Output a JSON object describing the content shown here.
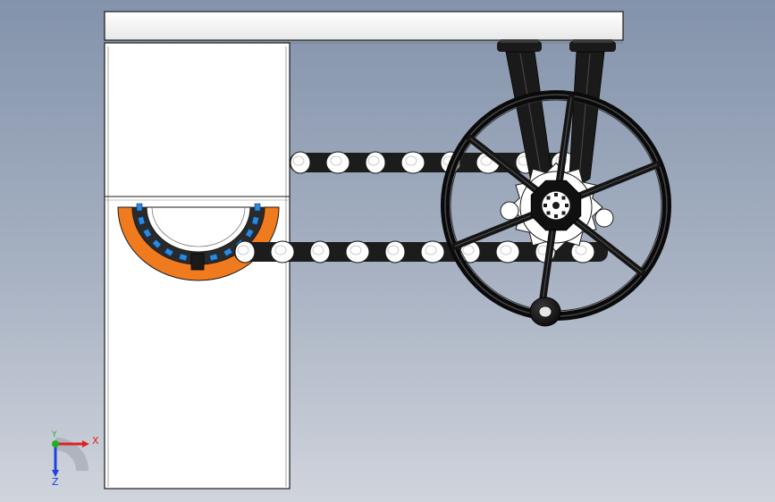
{
  "viewport": {
    "background": "gradient-grey-blue"
  },
  "model": {
    "components": [
      "top-beam",
      "vertical-column",
      "large-sprocket-cutaway",
      "roller-chain-top",
      "roller-chain-bottom",
      "small-sprocket",
      "handwheel",
      "handwheel-handle",
      "bracket-arms"
    ],
    "colors": {
      "body": "#ffffff",
      "outline": "#1a1a1a",
      "chain_plate": "#1c1c1c",
      "sprocket_ring": "#f07a1e",
      "bearing_blue": "#2a8ae0",
      "wheel": "#141414"
    },
    "handwheel_spokes": 6,
    "sprocket_teeth": 8
  },
  "triad": {
    "x_label": "X",
    "y_label": "Y",
    "z_label": "Z",
    "x_color": "#e02020",
    "y_color": "#20b020",
    "z_color": "#2040e0"
  }
}
